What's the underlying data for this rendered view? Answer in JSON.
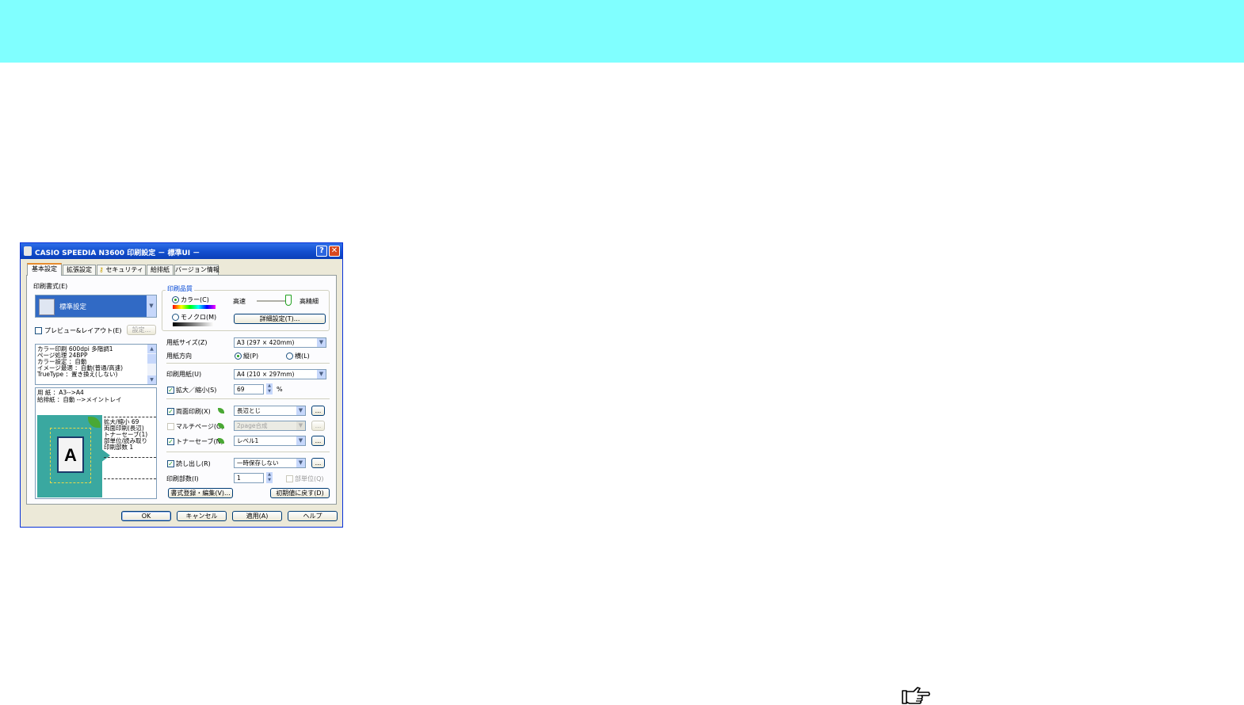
{
  "window": {
    "title": "CASIO SPEEDIA N3600 印刷設定 － 標準UI －",
    "help_glyph": "?",
    "close_glyph": "✕"
  },
  "tabs": [
    "基本設定",
    "拡張設定",
    "セキュリティ",
    "給排紙",
    "バージョン情報"
  ],
  "left": {
    "format_label": "印刷書式(E)",
    "format_value": "標準設定",
    "preview_label": "プレビュー&レイアウト(E)",
    "preview_checked": false,
    "settings_button": "設定...",
    "summary_lines": [
      "カラー印刷  600dpi  多階調1",
      "ページ処理  24BPP",
      "カラー設定  ：自動",
      "イメージ最適 ：自動(普通/高速)",
      "TrueType  ：置き換え(しない)"
    ],
    "paper_lines": [
      "用  紙 ：A3-->A4",
      "給排紙 ：自動 -->メイントレイ"
    ],
    "preview_letter": "A",
    "preview_notes": [
      "拡大/縮小 69",
      "両面印刷(長辺)",
      "トナーセーブ(1)",
      "部単位/読み取り",
      "印刷部数 1"
    ]
  },
  "right": {
    "quality_label": "印刷品質",
    "color_label": "カラー(C)",
    "mono_label": "モノクロ(M)",
    "mode": "color",
    "speed_label": "高速",
    "fine_label": "高精細",
    "detail_button": "詳細設定(T)...",
    "paper_size_label": "用紙サイズ(Z)",
    "paper_size_value": "A3 (297 × 420mm)",
    "orientation_label": "用紙方向",
    "portrait_label": "縦(P)",
    "landscape_label": "横(L)",
    "orientation": "portrait",
    "print_paper_label": "印刷用紙(U)",
    "print_paper_value": "A4 (210 × 297mm)",
    "scale_label": "拡大／縮小(S)",
    "scale_checked": true,
    "scale_value": "69",
    "scale_unit": "%",
    "duplex_label": "両面印刷(X)",
    "duplex_checked": true,
    "duplex_value": "長辺とじ",
    "multipage_label": "マルチページ(G)",
    "multipage_checked": false,
    "multipage_value": "2page合成",
    "tonersave_label": "トナーセーブ(N)",
    "tonersave_checked": true,
    "tonersave_value": "レベル1",
    "readout_label": "読し出し(R)",
    "readout_checked": true,
    "readout_value": "一時保存しない",
    "copies_label": "印刷部数(I)",
    "copies_value": "1",
    "collate_label": "部単位(Q)",
    "collate_checked": false,
    "more_button": "...",
    "register_button": "書式登録・編集(V)...",
    "reset_button": "初期値に戻す(D)"
  },
  "footer": {
    "ok": "OK",
    "cancel": "キャンセル",
    "apply": "適用(A)",
    "help": "ヘルプ"
  },
  "colors": {
    "banner": "#80ffff",
    "title_bar": "#1450d0",
    "preview_bg": "#3aa8a0",
    "accent": "#e68b2c"
  },
  "icons": {
    "page_icon": "pointing-hand-icon"
  }
}
